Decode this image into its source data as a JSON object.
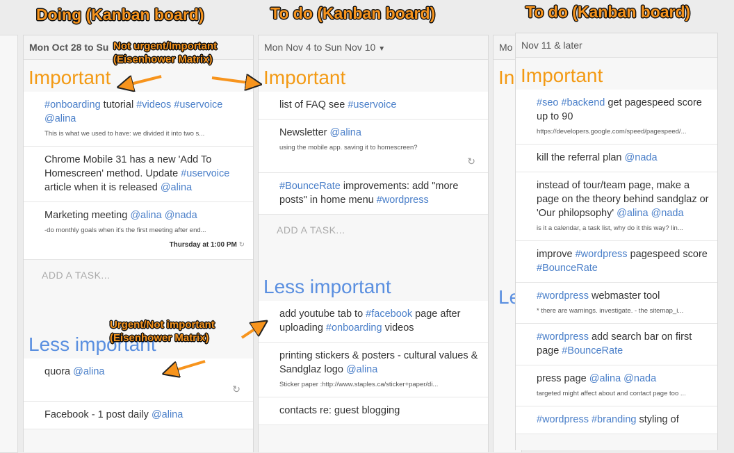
{
  "callouts": {
    "doing": "Doing (Kanban board)",
    "todo1": "To do (Kanban board)",
    "todo2": "To do (Kanban board)",
    "not_urgent_l1": "Not urgent/Important",
    "not_urgent_l2": "(Eisenhower Matrix)",
    "urgent_l1": "Urgent/Not important",
    "urgent_l2": "(Eisenhower Matrix)"
  },
  "colors": {
    "important": "#f39a14",
    "less_important": "#5a8fe0",
    "tag": "#4a7fc9",
    "callout": "#f7941d"
  },
  "col1": {
    "header": "Mon Oct 28 to Su",
    "important_title": "Important",
    "important_tasks": [
      {
        "a": "#onboarding",
        "b": " tutorial ",
        "c": "#videos",
        "d": "#uservoice",
        "e": " ",
        "f": "@alina",
        "note": "This is what we used to have: we divided it into two s..."
      },
      {
        "text": "Chrome Mobile 31 has a new 'Add To Homescreen' method. Update ",
        "tag1": "#uservoice",
        "text2": " article when it is released ",
        "tag2": "@alina"
      },
      {
        "text": "Marketing meeting ",
        "tag1": "@alina",
        "tag2": "@nada",
        "note": "-do monthly goals when it's the first meeting after end...",
        "due": "Thursday at 1:00 PM"
      }
    ],
    "add_task": "ADD A TASK...",
    "less_title": "Less important",
    "less_tasks": [
      {
        "text": "quora ",
        "tag1": "@alina"
      },
      {
        "text": "Facebook - 1 post daily ",
        "tag1": "@alina"
      }
    ]
  },
  "col2": {
    "header": "Mon Nov 4 to Sun Nov 10",
    "important_title": "Important",
    "important_tasks": [
      {
        "text": "list of FAQ see ",
        "tag1": "#uservoice"
      },
      {
        "text": "Newsletter ",
        "tag1": "@alina",
        "note": "using the mobile app. saving it to homescreen?"
      },
      {
        "tag1": "#BounceRate",
        "text": " improvements: add \"more posts\" in home menu ",
        "tag2": "#wordpress"
      }
    ],
    "add_task": "ADD A TASK...",
    "less_title": "Less important",
    "less_tasks": [
      {
        "text": "add youtube tab to ",
        "tag1": "#facebook",
        "text2": " page after uploading ",
        "tag2": "#onboarding",
        "text3": " videos"
      },
      {
        "text": "printing stickers & posters - cultural values & Sandglaz logo ",
        "tag1": "@alina",
        "note": "Sticker paper :http://www.staples.ca/sticker+paper/di..."
      },
      {
        "text": "contacts re: guest blogging"
      }
    ]
  },
  "col3": {
    "header": "Mo",
    "important_title": "In",
    "less_title": "Le"
  },
  "col4": {
    "header": "Nov 11 & later",
    "important_title": "Important",
    "tasks": [
      {
        "tag1": "#seo",
        "tag2": "#backend",
        "text": " get pagespeed score up to 90",
        "note": "https://developers.google.com/speed/pagespeed/..."
      },
      {
        "text": "kill the referral plan ",
        "tag1": "@nada"
      },
      {
        "text": "instead of tour/team page, make a page on the theory behind sandglaz or 'Our philopsophy' ",
        "tag1": "@alina",
        "tag2": "@nada",
        "note": "is it a calendar, a task list, why do it this way?  lin..."
      },
      {
        "text": "improve ",
        "tag1": "#wordpress",
        "text2": " pagespeed score ",
        "tag2": "#BounceRate"
      },
      {
        "tag1": "#wordpress",
        "text": " webmaster tool",
        "note": "* there are warnings. investigate. - the sitemap_i..."
      },
      {
        "tag1": "#wordpress",
        "text": " add search bar on first page ",
        "tag2": "#BounceRate"
      },
      {
        "text": "press page ",
        "tag1": "@alina",
        "tag2": "@nada",
        "note": "targeted might affect about and contact page too ..."
      },
      {
        "tag1": "#wordpress",
        "tag2": "#branding",
        "text": " styling of"
      }
    ]
  },
  "icons": {
    "refresh": "refresh-icon",
    "caret": "caret-down-icon"
  }
}
